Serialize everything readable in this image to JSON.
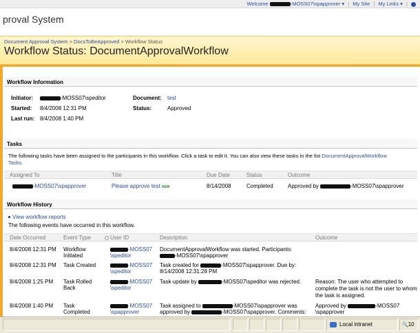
{
  "top": {
    "welcome": "Welcome",
    "user": "-MOSS07\\spapprover",
    "my_site": "My Site",
    "my_links": "My Links"
  },
  "site_name": "proval System",
  "breadcrumb": {
    "a": "Document Approval System",
    "b": "DocsToBeApproved",
    "c": "Workflow Status",
    "sep": ">"
  },
  "page_title": "Workflow Status: DocumentApprovalWorkflow",
  "info": {
    "heading": "Workflow Information",
    "initiator_label": "Initiator:",
    "initiator_value": "-MOSS07\\speditor",
    "started_label": "Started:",
    "started_value": "8/4/2008 12:31 PM",
    "lastrun_label": "Last run:",
    "lastrun_value": "8/4/2008 1:40 PM",
    "document_label": "Document:",
    "document_value": "test",
    "status_label": "Status:",
    "status_value": "Approved"
  },
  "tasks": {
    "heading": "Tasks",
    "desc": "The following tasks have been assigned to the participants in this workflow. Click a task to edit it. You can also view these tasks in the list",
    "desc_link": "DocumentApprovalWorkflow",
    "desc_link2": "Tasks.",
    "columns": [
      "Assigned To",
      "Title",
      "Due Date",
      "Status",
      "Outcome"
    ],
    "row": {
      "assigned": "-MOSS07\\spapprover",
      "title": "Please approve test",
      "new": "NEW",
      "due": "8/14/2008",
      "status": "Completed",
      "outcome_pre": "Approved by",
      "outcome_post": "-MOSS07\\spapprover"
    }
  },
  "history": {
    "heading": "Workflow History",
    "reports_link": "View workflow reports",
    "desc": "The following events have occurred in this workflow.",
    "columns": [
      "Date Occurred",
      "Event Type",
      "User ID",
      "Description",
      "Outcome"
    ],
    "rows": [
      {
        "date": "8/4/2008 12:31 PM",
        "event1": "Workflow",
        "event2": "Initiated",
        "user1": "-MOSS07",
        "user2": "\\speditor",
        "desc1": "DocumentApprovalWorkflow was started.  Participants:",
        "desc2": "-MOSS07\\spapprover",
        "out1": "",
        "out2": "",
        "out3": ""
      },
      {
        "date": "8/4/2008 12:31 PM",
        "event1": "Task Created",
        "event2": "",
        "user1": "-MOSS07",
        "user2": "\\speditor",
        "desc1": "Task created for",
        "desc1b": "-MOSS07\\spapprover.  Due by:",
        "desc2": "8/14/2008 12:31:28 PM",
        "out1": "",
        "out2": "",
        "out3": ""
      },
      {
        "date": "8/4/2008 1:25 PM",
        "event1": "Task Rolled",
        "event2": "Back",
        "user1": "-MOSS07",
        "user2": "\\speditor",
        "desc1": "Task update by",
        "desc1b": "-MOSS07\\speditor was rejected.",
        "desc2": "",
        "out1": "Reason: The user who attempted to",
        "out2": "complete the task is not the user to whom",
        "out3": "the task is assigned."
      },
      {
        "date": "8/4/2008 1:40 PM",
        "event1": "Task",
        "event2": "Completed",
        "user1": "-MOSS07",
        "user2": "\\spapprover",
        "desc1": "Task assigned to",
        "desc1b": "-MOSS07\\spapprover was",
        "desc2": "approved by",
        "desc2b": "-MOSS07\\spapprover.  Comments:",
        "out1": "Approved by",
        "out1b": "-MOSS07",
        "out2": "\\spapprover",
        "out3": ""
      }
    ]
  },
  "statusbar": {
    "zone": "Local intranet",
    "zoom": "10"
  }
}
